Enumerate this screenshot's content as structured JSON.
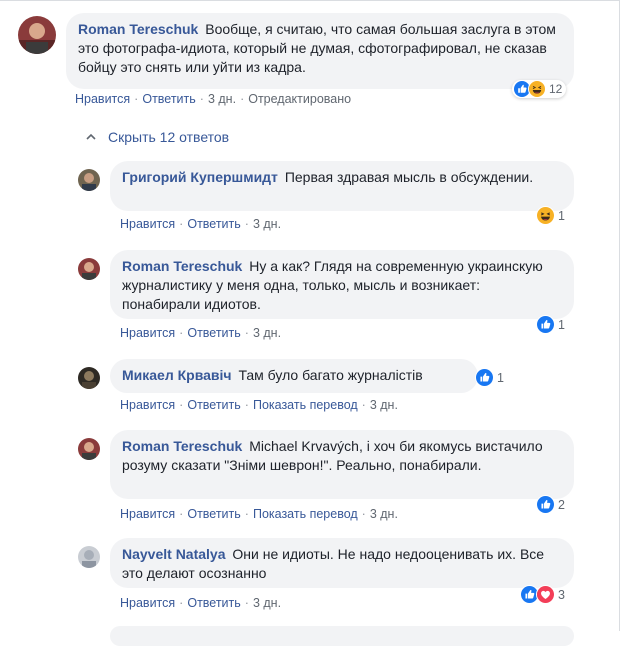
{
  "colors": {
    "link": "#385898",
    "bubble": "#f2f3f5",
    "meta": "#606770",
    "like_blue": "#1877f2",
    "haha_yellow": "#f7b125",
    "love_red": "#f33e58"
  },
  "action_labels": {
    "like": "Нравится",
    "reply": "Ответить",
    "translate": "Показать перевод",
    "edited": "Отредактировано"
  },
  "main_comment": {
    "author": "Roman Tereschuk",
    "text": "Вообще, я считаю, что самая большая заслуга в этом это фотографа-идиота, который не думая, сфотографировал, не сказав бойцу это снять или уйти из кадра.",
    "time": "3 дн.",
    "reactions": {
      "icons": [
        "like-icon",
        "haha-icon"
      ],
      "count": "12"
    }
  },
  "hide_replies_label": "Скрыть 12 ответов",
  "replies": [
    {
      "author": "Григорий Купершмидт",
      "text": "Первая здравая мысль в обсуждении.",
      "time": "3 дн.",
      "translate": false,
      "reactions": {
        "icons": [
          "haha-icon"
        ],
        "count": "1"
      }
    },
    {
      "author": "Roman Tereschuk",
      "text": "Ну а как? Глядя на современную украинскую журналистику у меня одна, только, мысль и возникает: понабирали идиотов.",
      "time": "3 дн.",
      "translate": false,
      "reactions": {
        "icons": [
          "like-icon"
        ],
        "count": "1"
      }
    },
    {
      "author": "Микаел Крвавіч",
      "text": "Там було багато журналістів",
      "time": "3 дн.",
      "translate": true,
      "reactions": {
        "icons": [
          "like-icon"
        ],
        "count": "1"
      }
    },
    {
      "author": "Roman Tereschuk",
      "text": "Michael Krvavých, і хоч би якомусь вистачило розуму сказати \"Зніми шеврон!\". Реально, понабирали.",
      "time": "3 дн.",
      "translate": true,
      "reactions": {
        "icons": [
          "like-icon"
        ],
        "count": "2"
      }
    },
    {
      "author": "Nayvelt Natalya",
      "text": "Они не идиоты. Не надо недооценивать их. Все это делают осознанно",
      "time": "3 дн.",
      "translate": false,
      "reactions": {
        "icons": [
          "like-icon",
          "love-icon"
        ],
        "count": "3"
      }
    }
  ]
}
